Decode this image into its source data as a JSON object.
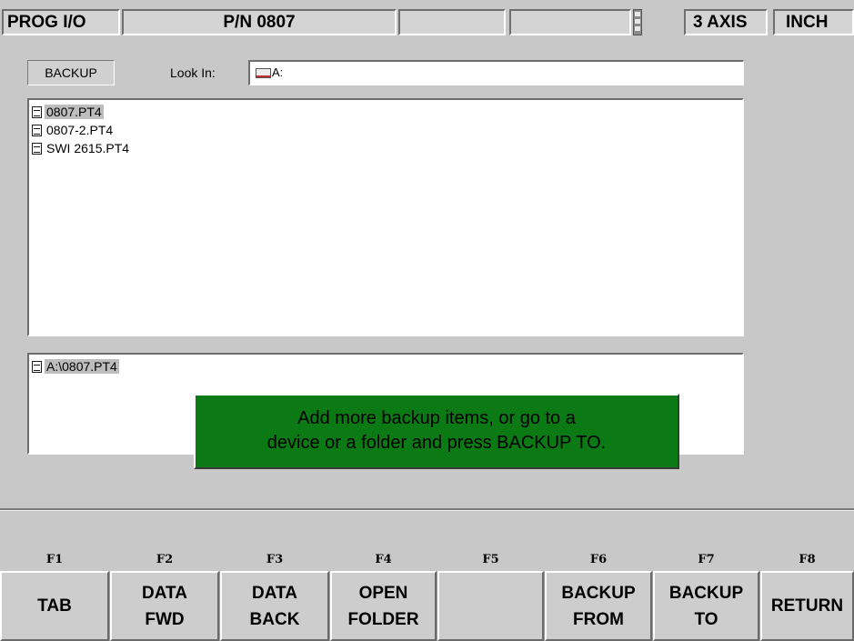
{
  "header": {
    "mode": "PROG I/O",
    "part_number": "P/N 0807",
    "axis": "3 AXIS",
    "units": "INCH"
  },
  "backup_bar": {
    "label": "BACKUP",
    "look_in_label": "Look In:",
    "look_in_value": "A:"
  },
  "file_list": [
    {
      "name": "0807.PT4",
      "selected": true
    },
    {
      "name": "0807-2.PT4",
      "selected": false
    },
    {
      "name": "SWI 2615.PT4",
      "selected": false
    }
  ],
  "backup_items": [
    {
      "name": "A:\\0807.PT4",
      "selected": true
    }
  ],
  "message": {
    "line1": "Add more backup items, or go to a",
    "line2": "device or a folder and press BACKUP TO.",
    "background": "#0c7a14"
  },
  "function_keys": [
    {
      "key": "F1",
      "line1": "TAB",
      "line2": ""
    },
    {
      "key": "F2",
      "line1": "DATA",
      "line2": "FWD"
    },
    {
      "key": "F3",
      "line1": "DATA",
      "line2": "BACK"
    },
    {
      "key": "F4",
      "line1": "OPEN",
      "line2": "FOLDER"
    },
    {
      "key": "F5",
      "line1": "",
      "line2": ""
    },
    {
      "key": "F6",
      "line1": "BACKUP",
      "line2": "FROM"
    },
    {
      "key": "F7",
      "line1": "BACKUP",
      "line2": "TO"
    },
    {
      "key": "F8",
      "line1": "RETURN",
      "line2": ""
    }
  ]
}
